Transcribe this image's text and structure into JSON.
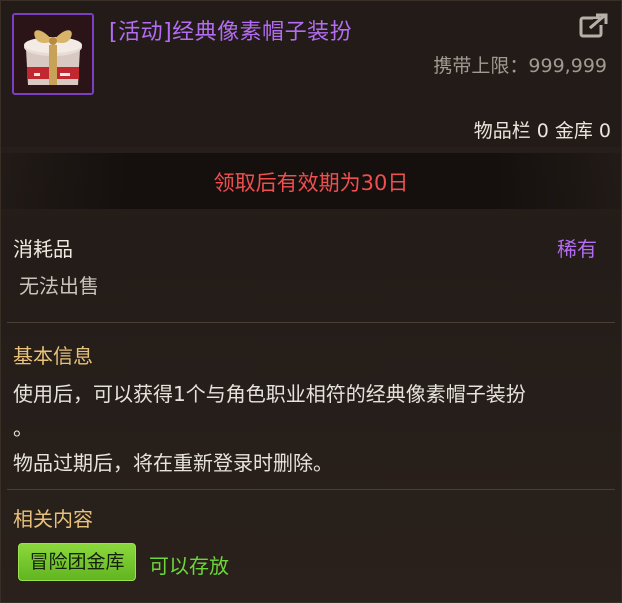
{
  "item": {
    "name": "[活动]经典像素帽子装扮",
    "carry_limit": "携带上限：999,999",
    "storage": "物品栏 0 金库 0"
  },
  "expiry": {
    "text": "领取后有效期为30日"
  },
  "type_section": {
    "type": "消耗品",
    "rarity": "稀有",
    "sell": "无法出售"
  },
  "basic_info": {
    "title": "基本信息",
    "line1": "使用后，可以获得1个与角色职业相符的经典像素帽子装扮",
    "line2": "。",
    "line3": "物品过期后，将在重新登录时删除。"
  },
  "related": {
    "title": "相关内容",
    "vault_button": "冒险团金库",
    "vault_status": "可以存放"
  },
  "colors": {
    "rarity_purple": "#b36cf2",
    "expire_red": "#ef4f4f",
    "section_gold": "#e8c27a",
    "accent_green": "#6cd63a"
  },
  "icons": {
    "item": "gift-box-icon",
    "share": "share-icon"
  }
}
